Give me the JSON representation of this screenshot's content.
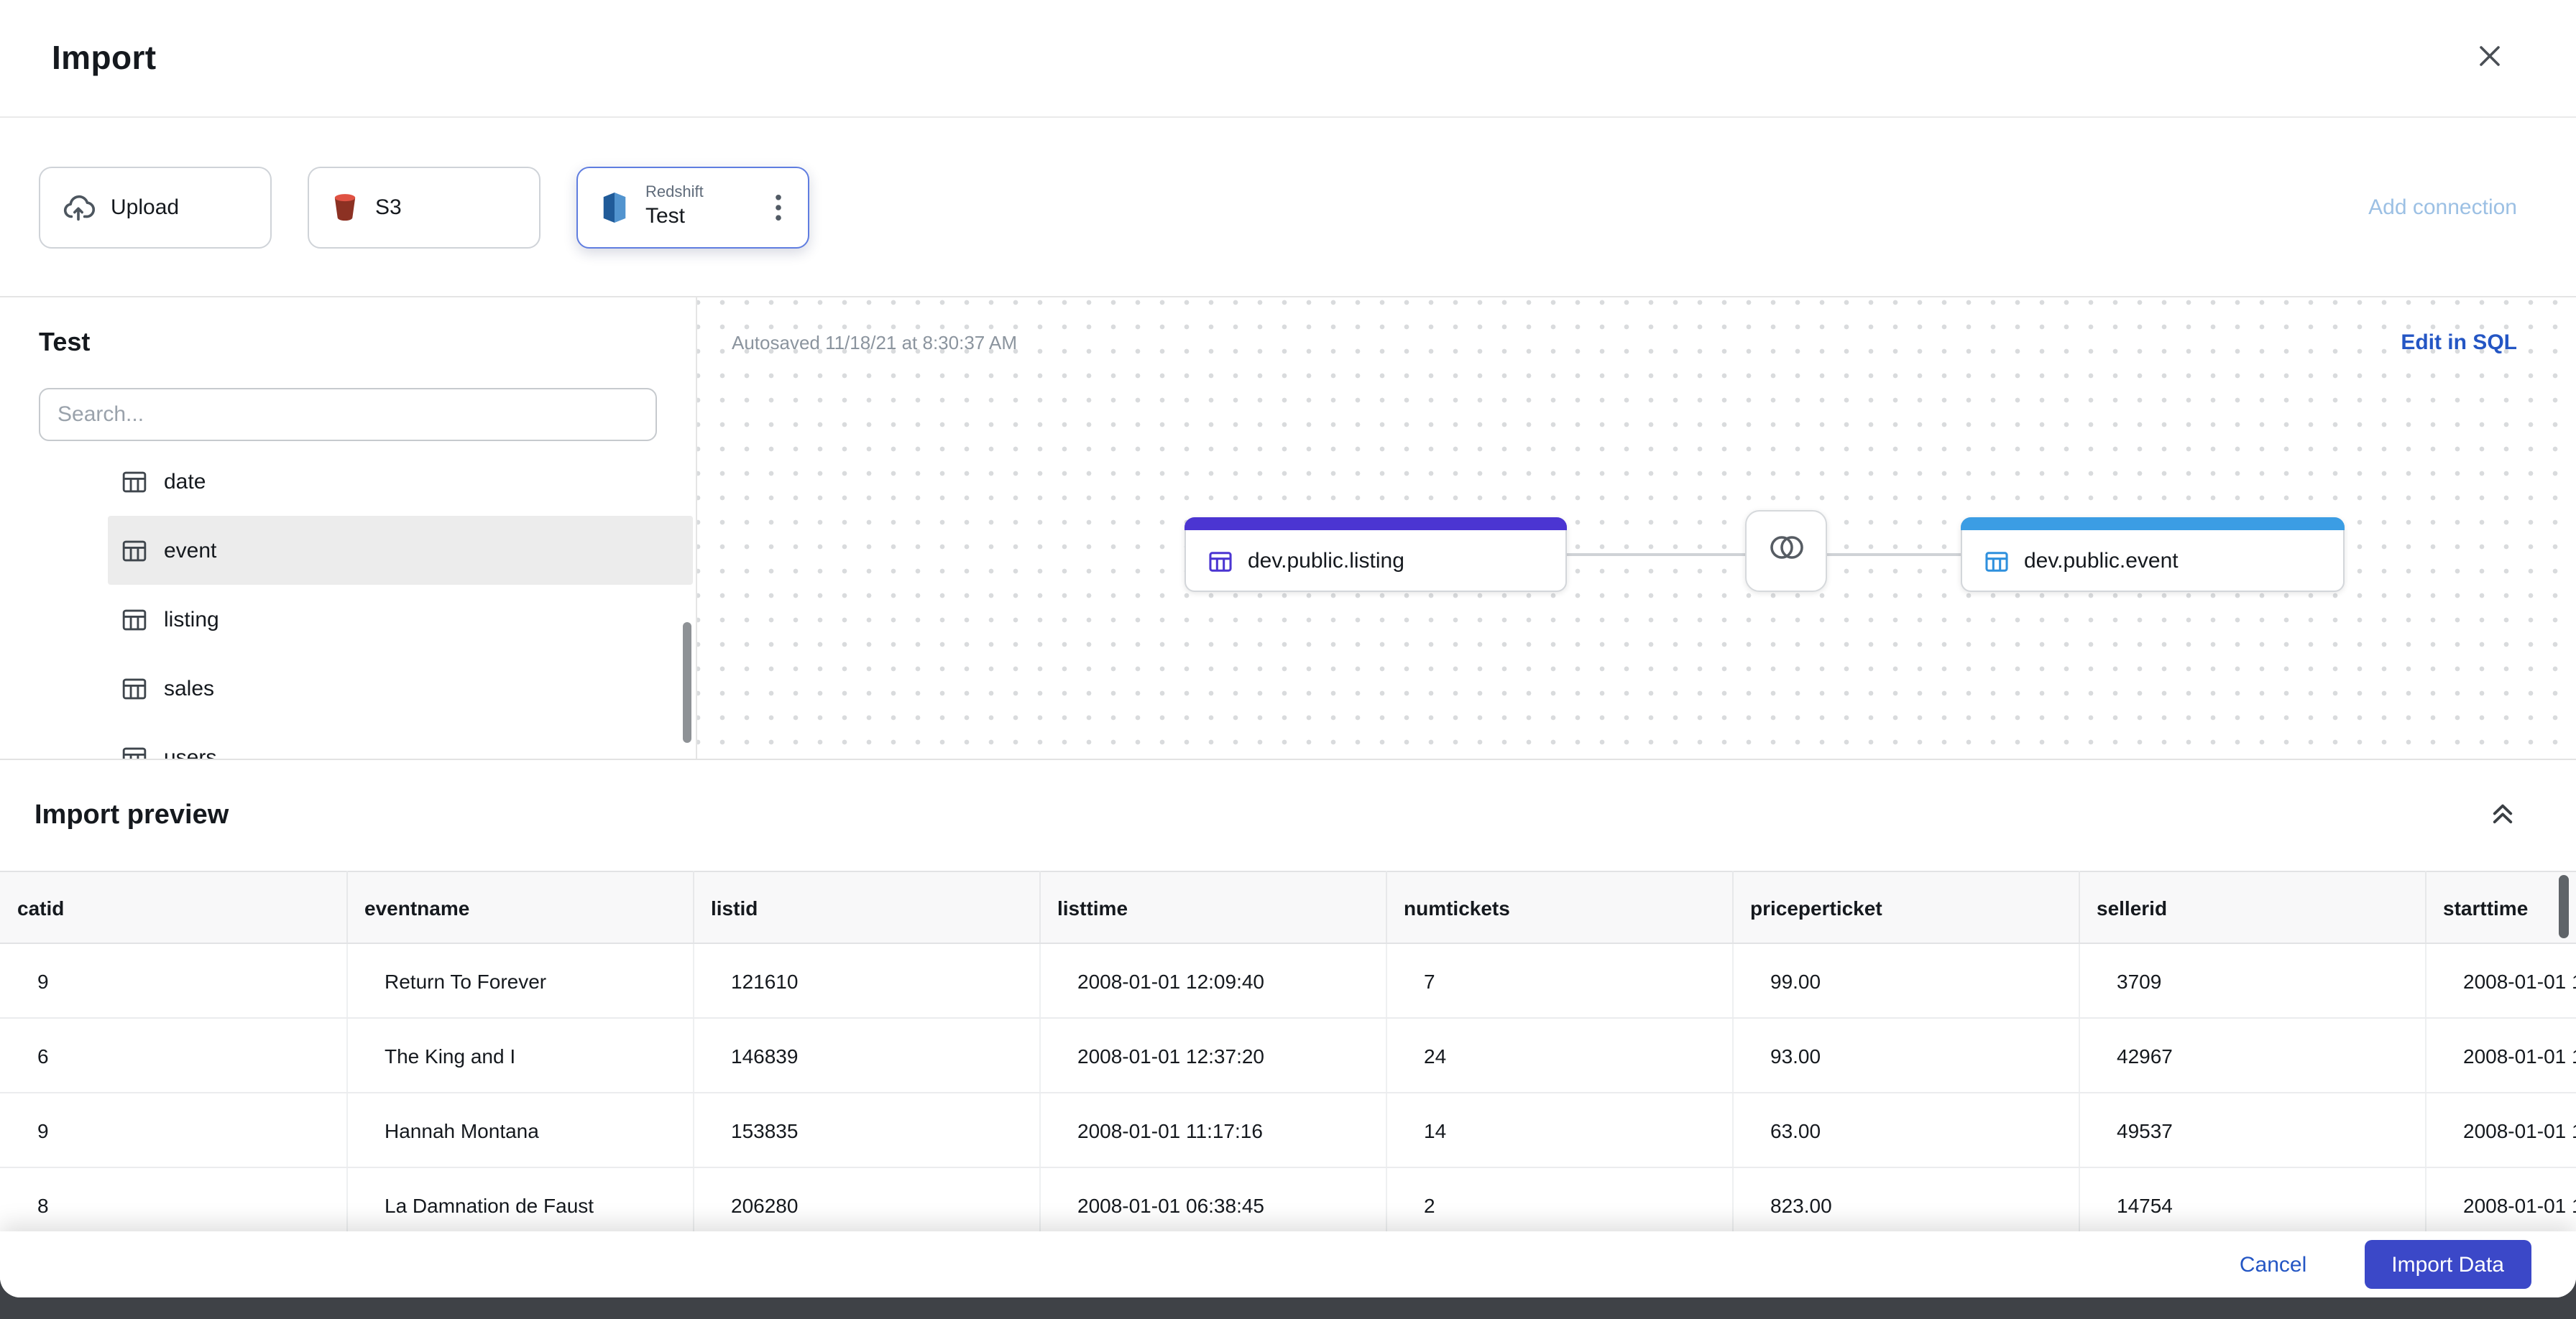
{
  "header": {
    "title": "Import"
  },
  "sources": {
    "upload_label": "Upload",
    "s3_label": "S3",
    "redshift_type": "Redshift",
    "redshift_name": "Test",
    "add_connection": "Add connection"
  },
  "sidebar": {
    "title": "Test",
    "search_placeholder": "Search...",
    "tables": [
      {
        "label": "date",
        "selected": false
      },
      {
        "label": "event",
        "selected": true
      },
      {
        "label": "listing",
        "selected": false
      },
      {
        "label": "sales",
        "selected": false
      },
      {
        "label": "users",
        "selected": false
      }
    ]
  },
  "canvas": {
    "autosaved": "Autosaved 11/18/21 at 8:30:37 AM",
    "edit_in_sql": "Edit in SQL",
    "nodes": [
      {
        "label": "dev.public.listing",
        "accent": "#4b35d2"
      },
      {
        "label": "dev.public.event",
        "accent": "#3b9de4"
      }
    ],
    "join_type": "join"
  },
  "preview": {
    "title": "Import preview",
    "columns": [
      "catid",
      "eventname",
      "listid",
      "listtime",
      "numtickets",
      "priceperticket",
      "sellerid",
      "starttime"
    ],
    "rows": [
      [
        "9",
        "Return To Forever",
        "121610",
        "2008-01-01 12:09:40",
        "7",
        "99.00",
        "3709",
        "2008-01-01 1"
      ],
      [
        "6",
        "The King and I",
        "146839",
        "2008-01-01 12:37:20",
        "24",
        "93.00",
        "42967",
        "2008-01-01 1"
      ],
      [
        "9",
        "Hannah Montana",
        "153835",
        "2008-01-01 11:17:16",
        "14",
        "63.00",
        "49537",
        "2008-01-01 1"
      ],
      [
        "8",
        "La Damnation de Faust",
        "206280",
        "2008-01-01 06:38:45",
        "2",
        "823.00",
        "14754",
        "2008-01-01 1"
      ]
    ]
  },
  "footer": {
    "cancel": "Cancel",
    "import": "Import Data"
  },
  "icons": {
    "close": "close-icon",
    "upload": "cloud-upload-icon",
    "s3": "s3-bucket-icon",
    "redshift": "redshift-icon",
    "kebab": "kebab-menu-icon",
    "table": "table-grid-icon",
    "join": "inner-join-icon",
    "collapse": "double-chevron-up-icon"
  },
  "colors": {
    "primary_button": "#3b48c8",
    "link_blue": "#2456c4",
    "add_connection_blue": "#9cc0e4",
    "listing_accent": "#4b35d2",
    "event_accent": "#3b9de4",
    "selected_card_border": "#5f7de0",
    "s3_red": "#8c3123",
    "redshift_blue": "#205b99"
  }
}
